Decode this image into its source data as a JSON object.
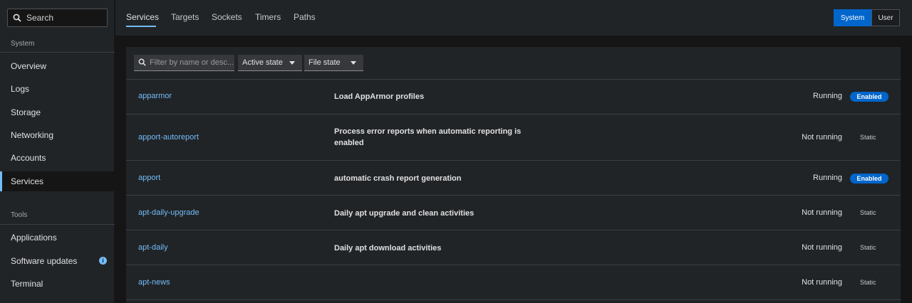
{
  "sidebar": {
    "search_label": "Search",
    "sections": [
      {
        "title": "System",
        "items": [
          "Overview",
          "Logs",
          "Storage",
          "Networking",
          "Accounts",
          "Services"
        ]
      },
      {
        "title": "Tools",
        "items": [
          "Applications",
          "Software updates",
          "Terminal"
        ]
      }
    ],
    "active_item": "Services",
    "software_updates_badge": "i"
  },
  "tabs": [
    "Services",
    "Targets",
    "Sockets",
    "Timers",
    "Paths"
  ],
  "active_tab": "Services",
  "scope_toggle": {
    "system": "System",
    "user": "User",
    "selected": "System"
  },
  "filters": {
    "search_placeholder": "Filter by name or desc...",
    "active_state": "Active state",
    "file_state": "File state"
  },
  "services": [
    {
      "name": "apparmor",
      "description": "Load AppArmor profiles",
      "state": "Running",
      "file_state": "Enabled"
    },
    {
      "name": "apport-autoreport",
      "description": "Process error reports when automatic reporting is enabled",
      "state": "Not running",
      "file_state": "Static"
    },
    {
      "name": "apport",
      "description": "automatic crash report generation",
      "state": "Running",
      "file_state": "Enabled"
    },
    {
      "name": "apt-daily-upgrade",
      "description": "Daily apt upgrade and clean activities",
      "state": "Not running",
      "file_state": "Static"
    },
    {
      "name": "apt-daily",
      "description": "Daily apt download activities",
      "state": "Not running",
      "file_state": "Static"
    },
    {
      "name": "apt-news",
      "description": "",
      "state": "Not running",
      "file_state": "Static"
    }
  ],
  "colors": {
    "accent": "#73bcf7",
    "primary": "#0066cc",
    "background": "#151515",
    "surface": "#212427"
  }
}
